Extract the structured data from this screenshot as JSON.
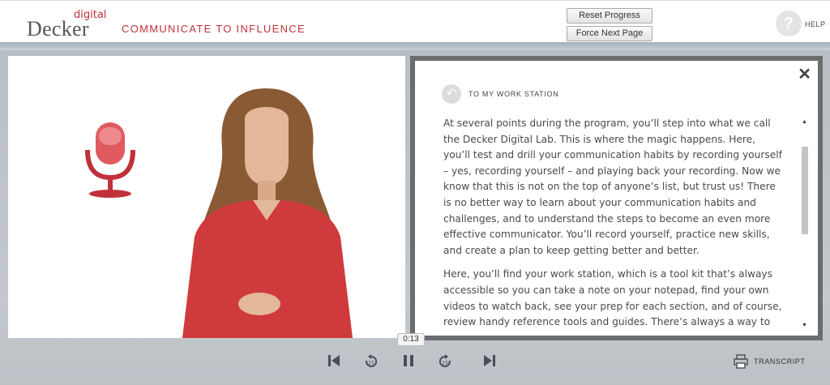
{
  "brand": {
    "logo_sup": "digital",
    "logo_main": "Decker"
  },
  "course_title": "COMMUNICATE TO INFLUENCE",
  "header_buttons": {
    "reset": "Reset Progress",
    "force_next": "Force Next Page"
  },
  "help": {
    "icon_glyph": "?",
    "label": "HELP"
  },
  "panel": {
    "back_label": "TO MY WORK STATION",
    "close_glyph": "✕",
    "paragraphs": [
      "At several points during the program, you’ll step into what we call the Decker Digital Lab. This is where the magic happens. Here, you’ll test and drill your communication habits by recording yourself – yes, recording yourself – and playing back your recording. Now we know that this is not on the top of anyone’s list, but trust us! There is no better way to learn about your communication habits and challenges, and to understand the steps to become an even more effective communicator. You’ll record yourself, practice new skills, and create a plan to keep getting better and better.",
      "Here, you’ll find your work station, which is a tool kit that’s always accessible so you can take a note on your notepad, find your own videos to watch back, see your prep for each section, and of course, review handy reference tools and guides. There’s always a way to get"
    ]
  },
  "player": {
    "time": "0:13",
    "transcript_label": "TRANSCRIPT"
  },
  "colors": {
    "brand_red": "#c0323a",
    "frame_gray": "#6a6d70",
    "stage": "#c5c9cd"
  },
  "icons": [
    "microphone-icon",
    "back-arrow-icon",
    "close-icon",
    "skip-back-icon",
    "rewind-icon",
    "pause-icon",
    "forward-icon",
    "skip-forward-icon",
    "transcript-icon",
    "help-icon"
  ]
}
